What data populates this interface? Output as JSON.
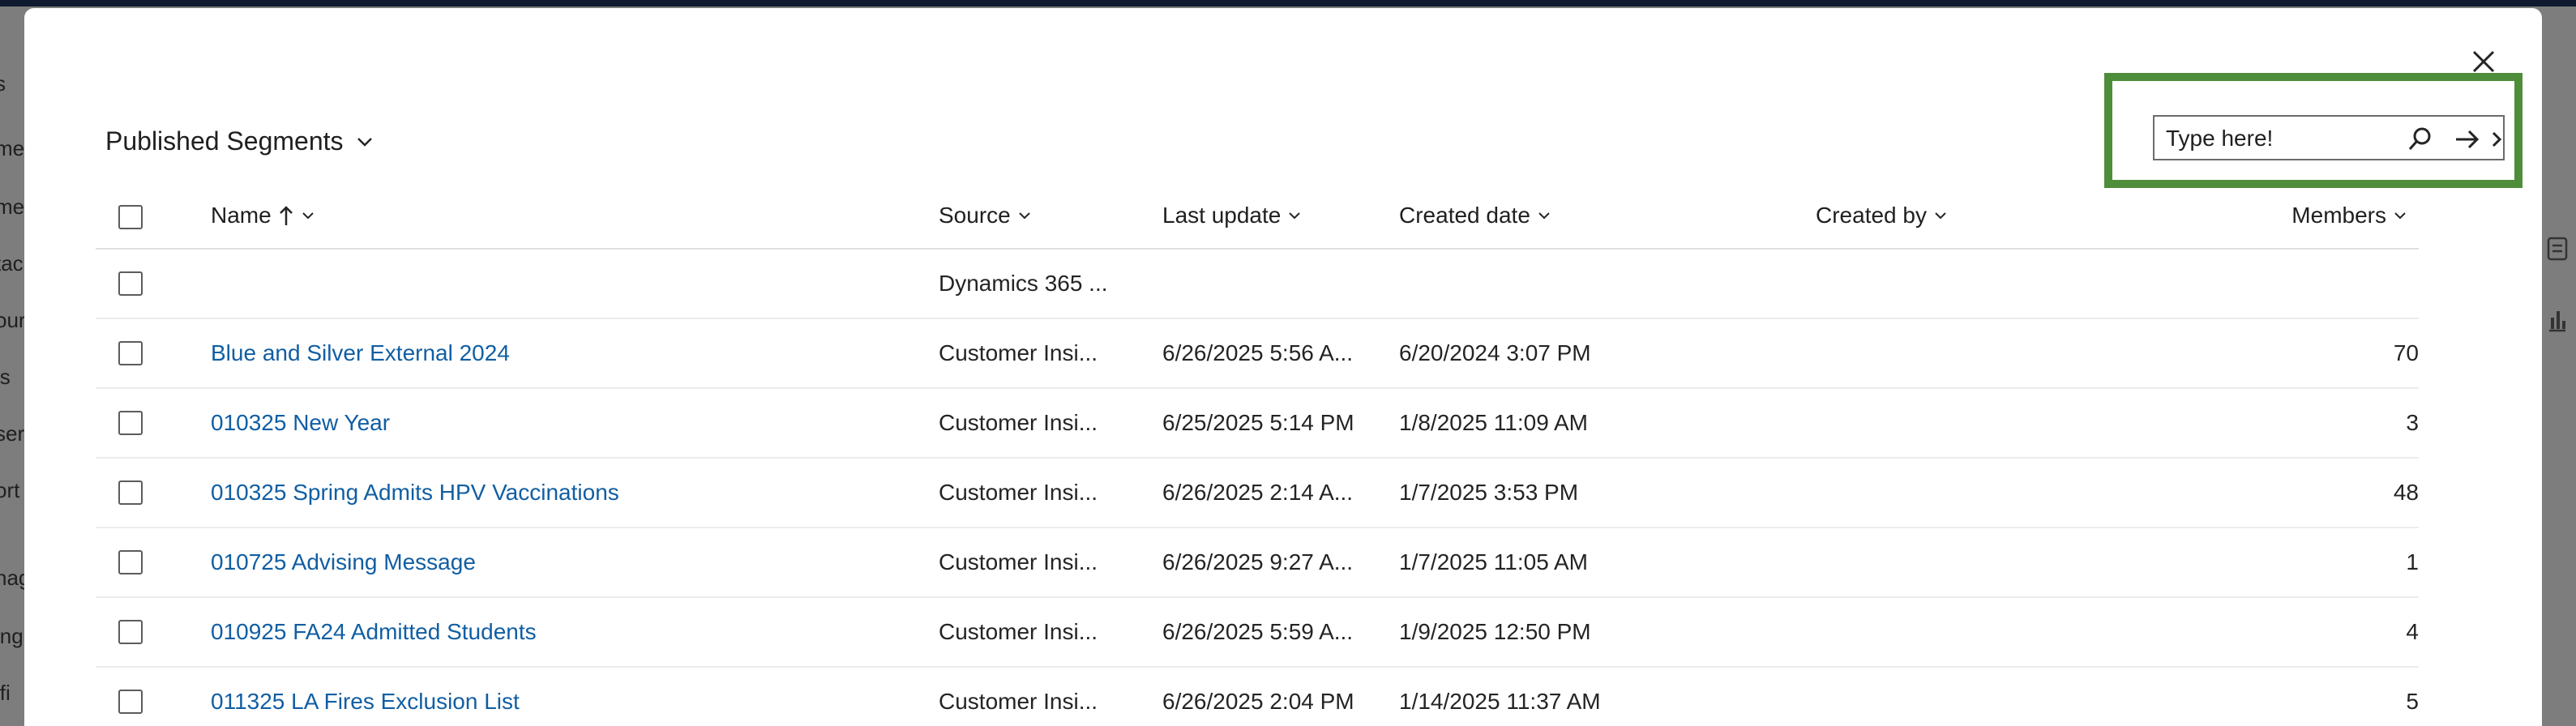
{
  "background": {
    "left_fragments": [
      "s",
      "me",
      "me",
      "tac",
      "our",
      "ls",
      "ser",
      "ort",
      "nag",
      "ing",
      "ifi"
    ],
    "right_icons": [
      "ticket-icon",
      "chart-icon"
    ]
  },
  "dialog": {
    "title": "Published Segments",
    "search": {
      "placeholder": "Type here!",
      "value": ""
    },
    "highlight_color": "#4e8d3a",
    "columns": {
      "name": "Name",
      "source": "Source",
      "last_update": "Last update",
      "created_date": "Created date",
      "created_by": "Created by",
      "members": "Members"
    },
    "rows": [
      {
        "name": "",
        "source": "Dynamics 365 ...",
        "last_update": "",
        "created_date": "",
        "created_by": "",
        "members": ""
      },
      {
        "name": "Blue and Silver External 2024",
        "source": "Customer Insi...",
        "last_update": "6/26/2025 5:56 A...",
        "created_date": "6/20/2024 3:07 PM",
        "created_by": "",
        "members": "70"
      },
      {
        "name": "010325 New Year",
        "source": "Customer Insi...",
        "last_update": "6/25/2025 5:14 PM",
        "created_date": "1/8/2025 11:09 AM",
        "created_by": "",
        "members": "3"
      },
      {
        "name": "010325 Spring Admits HPV Vaccinations",
        "source": "Customer Insi...",
        "last_update": "6/26/2025 2:14 A...",
        "created_date": "1/7/2025 3:53 PM",
        "created_by": "",
        "members": "48"
      },
      {
        "name": "010725 Advising Message",
        "source": "Customer Insi...",
        "last_update": "6/26/2025 9:27 A...",
        "created_date": "1/7/2025 11:05 AM",
        "created_by": "",
        "members": "1"
      },
      {
        "name": "010925 FA24 Admitted Students",
        "source": "Customer Insi...",
        "last_update": "6/26/2025 5:59 A...",
        "created_date": "1/9/2025 12:50 PM",
        "created_by": "",
        "members": "4"
      },
      {
        "name": "011325 LA Fires Exclusion List",
        "source": "Customer Insi...",
        "last_update": "6/26/2025 2:04 PM",
        "created_date": "1/14/2025 11:37 AM",
        "created_by": "",
        "members": "5"
      }
    ]
  }
}
